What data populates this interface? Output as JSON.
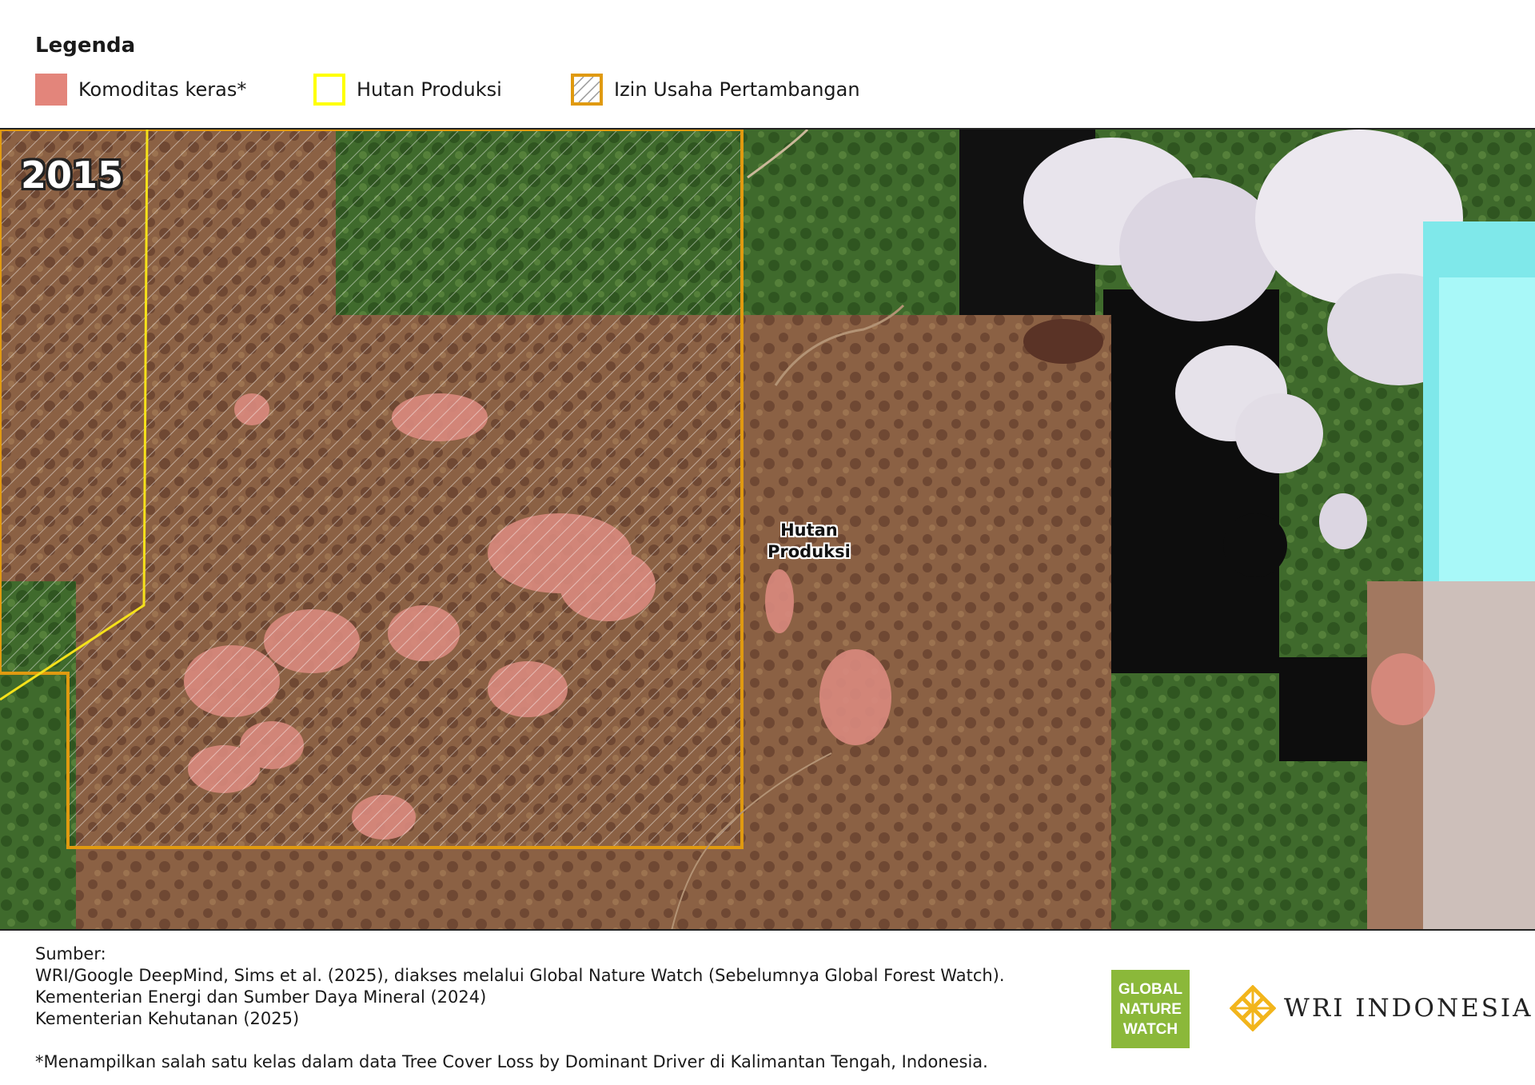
{
  "legend": {
    "title": "Legenda",
    "items": [
      {
        "label": "Komoditas keras*",
        "color": "#e3857b"
      },
      {
        "label": "Hutan Produksi",
        "color": "#ffff00"
      },
      {
        "label": "Izin Usaha Pertambangan",
        "color": "#e09a10"
      }
    ]
  },
  "map": {
    "year": "2015",
    "label_line1": "Hutan",
    "label_line2": "Produksi"
  },
  "sources": {
    "heading": "Sumber:",
    "lines": [
      "WRI/Google DeepMind, Sims et al. (2025), diakses melalui Global Nature Watch (Sebelumnya Global Forest Watch).",
      "Kementerian Energi dan Sumber Daya Mineral (2024)",
      "Kementerian Kehutanan (2025)"
    ]
  },
  "footnote": "*Menampilkan salah satu kelas dalam data Tree Cover Loss by Dominant Driver di Kalimantan Tengah, Indonesia.",
  "logos": {
    "gnw": [
      "GLOBAL",
      "NATURE",
      "WATCH"
    ],
    "wri": "WRI INDONESIA"
  }
}
